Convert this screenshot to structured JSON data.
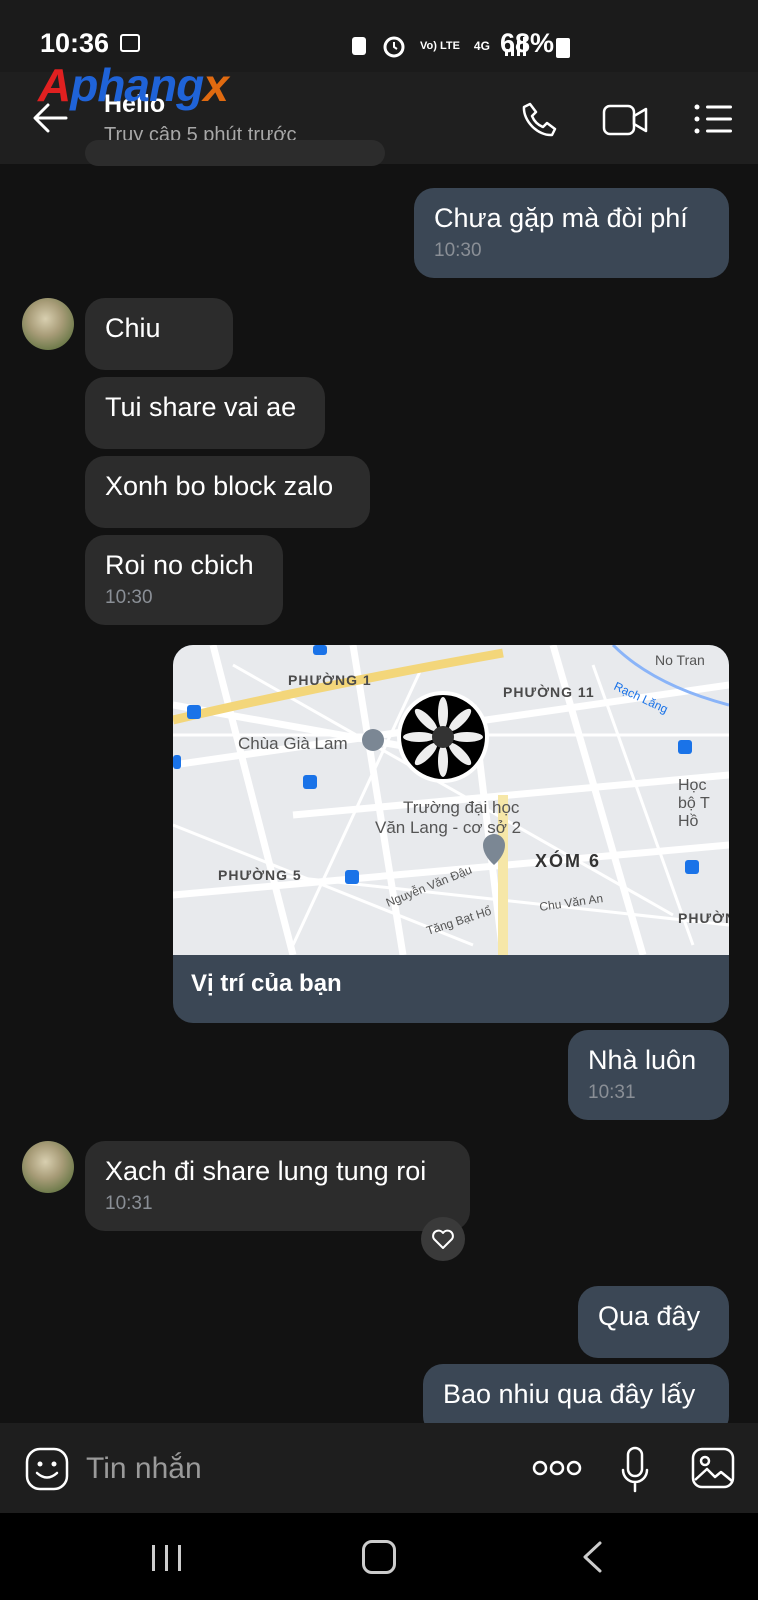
{
  "status_bar": {
    "time": "10:36",
    "battery": "68%",
    "network": "4G",
    "volte": "Vo) LTE"
  },
  "watermark": "Aphangx",
  "header": {
    "title": "Hello",
    "subtitle": "Truy cập 5 phút trước"
  },
  "messages": {
    "m1": {
      "text": "Chưa gặp mà đòi phí",
      "time": "10:30"
    },
    "m2": {
      "text": "Chiu"
    },
    "m3": {
      "text": "Tui share vai ae"
    },
    "m4": {
      "text": "Xonh bo block zalo"
    },
    "m5": {
      "text": "Roi no cbich",
      "time": "10:30"
    },
    "location": {
      "caption": "Vị trí của bạn",
      "map_labels": {
        "phuong1": "PHƯỜNG 1",
        "phuong11": "PHƯỜNG 11",
        "phuong5": "PHƯỜNG 5",
        "chua": "Chùa Già Lam",
        "truong1": "Trường đại học",
        "truong2": "Văn Lang - cơ sở 2",
        "xom6": "XÓM 6",
        "nguyen": "Nguyễn Văn Đậu",
        "tang": "Tăng Bạt Hổ",
        "chu": "Chu Văn An",
        "notran": "No Tran",
        "rach": "Rạch Lăng",
        "hoc": "Học",
        "bo": "bộ T",
        "ho": "Hồ",
        "phuongR": "PHƯỜNG"
      }
    },
    "m6": {
      "text": "Nhà luôn",
      "time": "10:31"
    },
    "m7": {
      "text": "Xach đi share lung tung roi",
      "time": "10:31"
    },
    "m8": {
      "text": "Qua đây"
    },
    "m9": {
      "text": "Bao nhiu qua đây lấy"
    }
  },
  "input": {
    "placeholder": "Tin nhắn"
  },
  "colors": {
    "bubble_me": "#3b4755",
    "bubble_them": "#2c2c2c",
    "background": "#121212"
  }
}
